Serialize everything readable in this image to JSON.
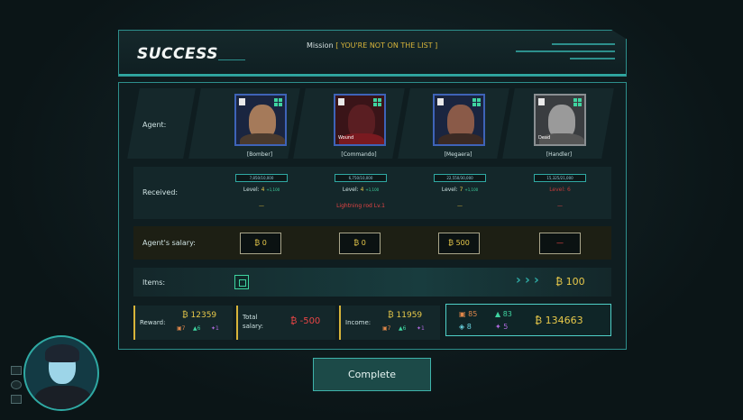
{
  "header": {
    "title": "SUCCESS",
    "mission_label": "Mission",
    "mission_name": "[ YOU'RE NOT ON THE LIST ]"
  },
  "rows": {
    "agent_label": "Agent:",
    "received_label": "Received:",
    "salary_label": "Agent's salary:",
    "items_label": "Items:"
  },
  "agents": [
    {
      "name": "[Bomber]",
      "xp": "7,850/10,000",
      "level_label": "Level:",
      "level": "4",
      "gain": "+1,100",
      "extra": "—",
      "salary": "0",
      "status": ""
    },
    {
      "name": "[Commando]",
      "xp": "6,750/10,000",
      "level_label": "Level:",
      "level": "4",
      "gain": "+1,100",
      "extra": "Lightning rod Lv.1",
      "salary": "0",
      "status": "Wound"
    },
    {
      "name": "[Megaera]",
      "xp": "22,550/30,000",
      "level_label": "Level:",
      "level": "7",
      "gain": "+1,100",
      "extra": "—",
      "salary": "500",
      "status": ""
    },
    {
      "name": "[Handler]",
      "xp": "15,325/21,000",
      "level_label": "Level:",
      "level": "6",
      "gain": "",
      "extra": "—",
      "salary": "—",
      "status": "Dead"
    }
  ],
  "items": {
    "value": "100"
  },
  "summary": {
    "reward_label": "Reward:",
    "reward_money": "12359",
    "reward_res": [
      "7",
      "6",
      "1"
    ],
    "total_salary_label": "Total salary:",
    "total_salary": "-500",
    "income_label": "Income:",
    "income_money": "11959",
    "income_res": [
      "7",
      "6",
      "1"
    ],
    "totals": {
      "orange": "85",
      "green": "83",
      "teal": "8",
      "purple": "5",
      "money": "134663"
    }
  },
  "complete_label": "Complete",
  "colors": {
    "accent": "#2fa9a3",
    "gold": "#e8c94a",
    "red": "#e84545"
  }
}
